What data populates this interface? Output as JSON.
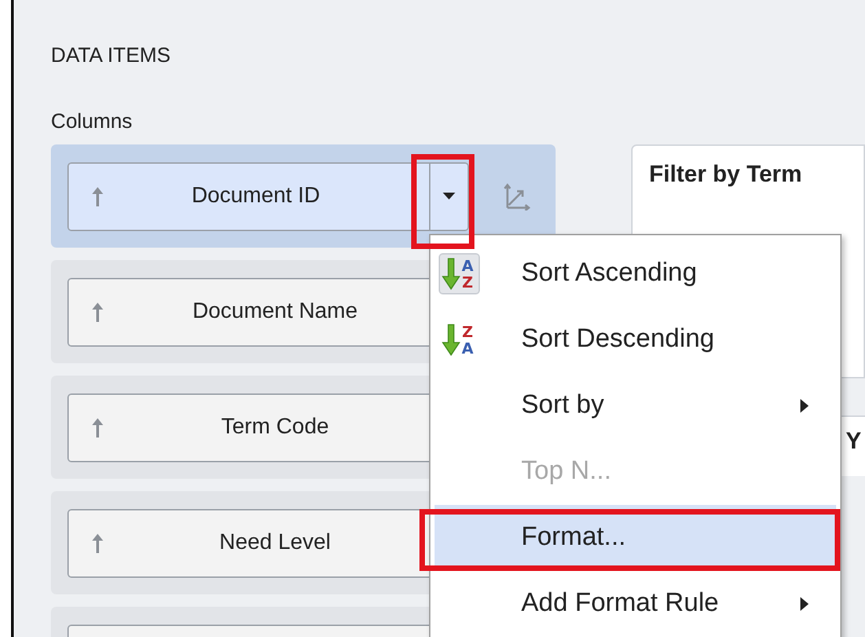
{
  "section_title": "DATA ITEMS",
  "group_label": "Columns",
  "columns": [
    {
      "label": "Document ID",
      "selected": true
    },
    {
      "label": "Document Name",
      "selected": false
    },
    {
      "label": "Term Code",
      "selected": false
    },
    {
      "label": "Need Level",
      "selected": false
    },
    {
      "selected": false
    }
  ],
  "filter_panel": {
    "title": "Filter by Term"
  },
  "second_panel": {
    "title": "Y"
  },
  "context_menu": [
    {
      "label": "Sort Ascending",
      "kind": "sort",
      "icon_letters": [
        "A",
        "Z"
      ],
      "selected": true,
      "disabled": false,
      "submenu": false,
      "highlighted": false
    },
    {
      "label": "Sort Descending",
      "kind": "sort",
      "icon_letters": [
        "Z",
        "A"
      ],
      "selected": false,
      "disabled": false,
      "submenu": false,
      "highlighted": false
    },
    {
      "label": "Sort by",
      "kind": "plain",
      "disabled": false,
      "submenu": true,
      "highlighted": false
    },
    {
      "label": "Top N...",
      "kind": "plain",
      "disabled": true,
      "submenu": false,
      "highlighted": false
    },
    {
      "label": "Format...",
      "kind": "plain",
      "disabled": false,
      "submenu": false,
      "highlighted": true
    },
    {
      "label": "Add Format Rule",
      "kind": "plain",
      "disabled": false,
      "submenu": true,
      "highlighted": false
    }
  ]
}
